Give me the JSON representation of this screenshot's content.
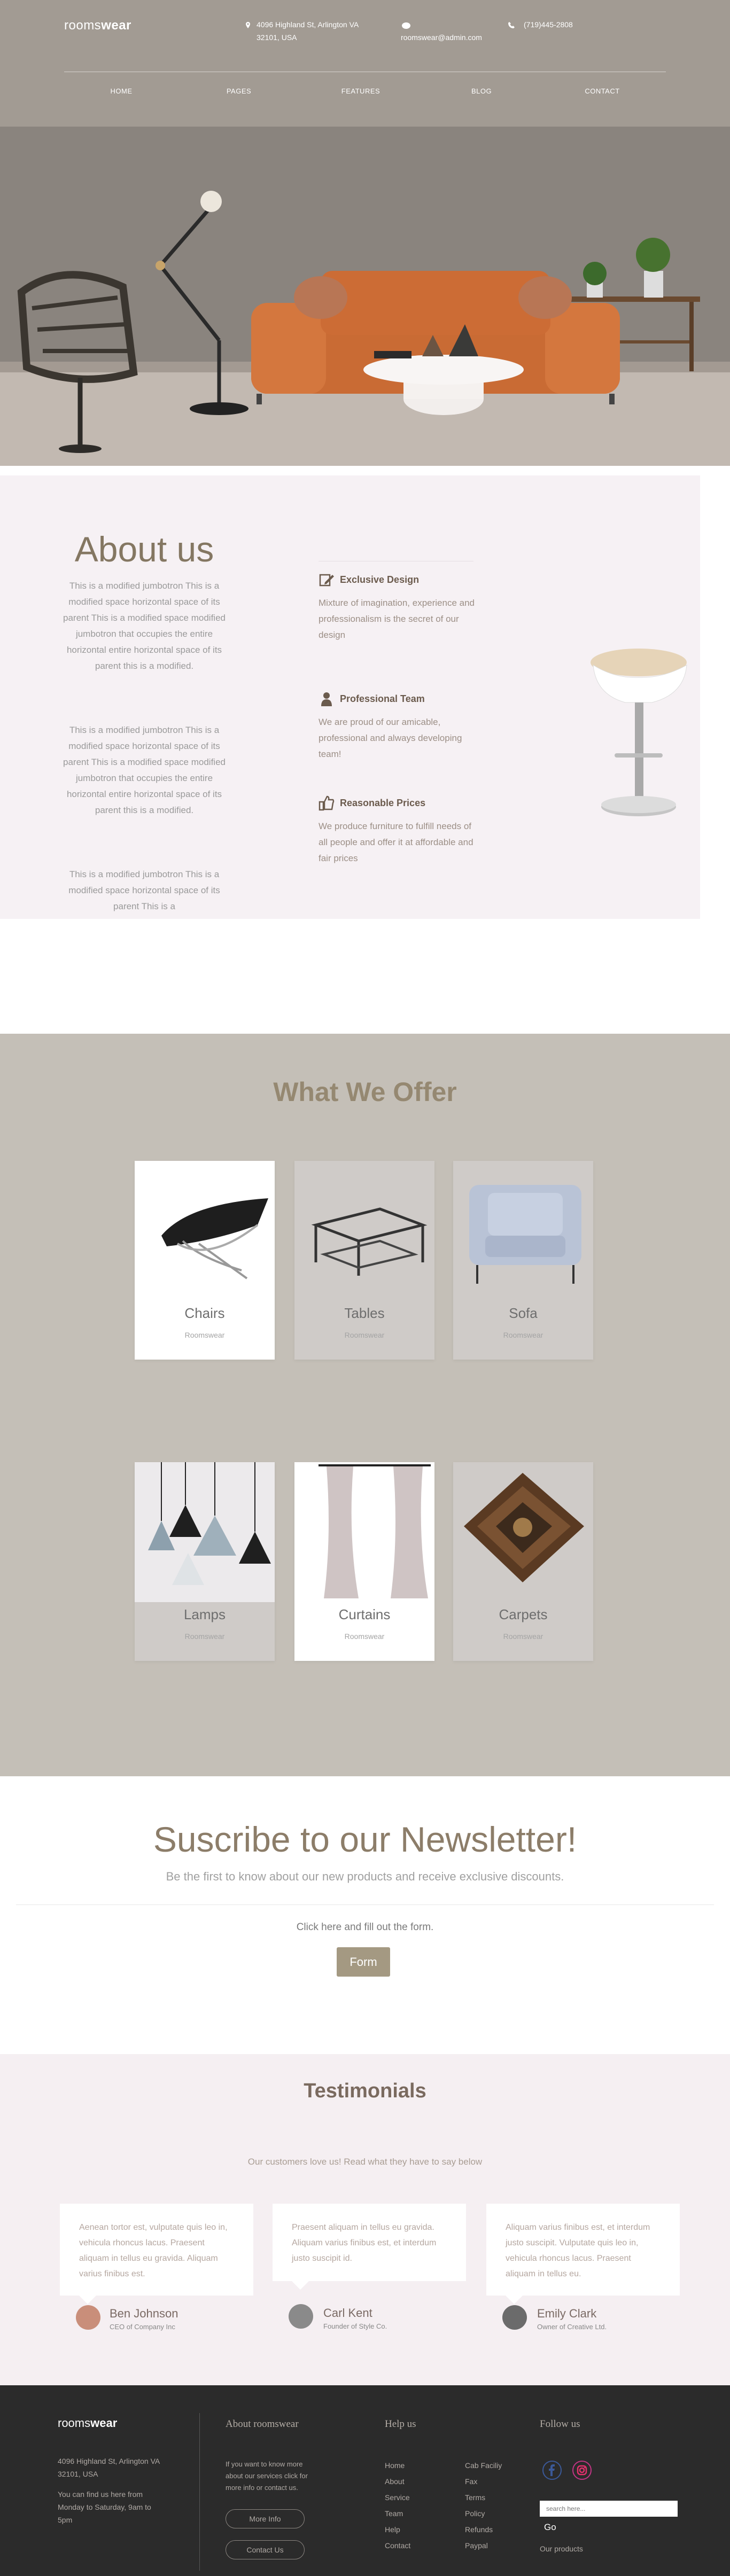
{
  "header": {
    "logo_light": "rooms",
    "logo_bold": "wear",
    "address_line1": "4096 Highland St, Arlington VA",
    "address_line2": "32101, USA",
    "email": "roomswear@admin.com",
    "phone": "(719)445-2808",
    "nav": [
      "HOME",
      "PAGES",
      "FEATURES",
      "BLOG",
      "CONTACT"
    ]
  },
  "about": {
    "title": "About us",
    "paragraphs": [
      "This is a modified jumbotron This is a modified space horizontal space of its parent This is a modified space modified jumbotron that occupies the entire horizontal entire horizontal space of its parent this is a modified.",
      "This is a modified jumbotron This is a modified space horizontal space of its parent This is a modified space modified jumbotron that occupies the entire horizontal entire horizontal space of its parent this is a modified.",
      "This is a modified jumbotron This is a modified space horizontal space of its parent This is a"
    ],
    "features": [
      {
        "title": "Exclusive Design",
        "text": "Mixture of imagination, experience and professionalism is the secret of our design",
        "icon": "edit-icon"
      },
      {
        "title": "Professional Team",
        "text": "We are proud of our amicable, professional and always developing team!",
        "icon": "person-icon"
      },
      {
        "title": "Reasonable Prices",
        "text": "We produce furniture to fulfill needs of all people and offer it at affordable and fair prices",
        "icon": "thumbs-up-icon"
      }
    ]
  },
  "offer": {
    "title": "What We Offer",
    "cards": [
      {
        "title": "Chairs",
        "sub": "Roomswear",
        "icon": "chair-icon"
      },
      {
        "title": "Tables",
        "sub": "Roomswear",
        "icon": "table-icon"
      },
      {
        "title": "Sofa",
        "sub": "Roomswear",
        "icon": "sofa-icon"
      },
      {
        "title": "Lamps",
        "sub": "Roomswear",
        "icon": "lamp-icon"
      },
      {
        "title": "Curtains",
        "sub": "Roomswear",
        "icon": "curtain-icon"
      },
      {
        "title": "Carpets",
        "sub": "Roomswear",
        "icon": "carpet-icon"
      }
    ]
  },
  "newsletter": {
    "title": "Suscribe to our Newsletter!",
    "subtitle": "Be the first to know about our new products and receive exclusive discounts.",
    "cta": "Click here and fill out the form.",
    "button": "Form"
  },
  "testimonials": {
    "title": "Testimonials",
    "subtitle": "Our customers love us! Read what they have to say below",
    "items": [
      {
        "text": "Aenean tortor est, vulputate quis leo in, vehicula rhoncus lacus. Praesent aliquam in tellus eu gravida. Aliquam varius finibus est.",
        "name": "Ben Johnson",
        "role": "CEO of Company Inc"
      },
      {
        "text": "Praesent aliquam in tellus eu gravida. Aliquam varius finibus est, et interdum justo suscipit id.",
        "name": "Carl Kent",
        "role": "Founder of Style Co."
      },
      {
        "text": "Aliquam varius finibus est, et interdum justo suscipit. Vulputate quis leo in, vehicula rhoncus lacus. Praesent aliquam in tellus eu.",
        "name": "Emily Clark",
        "role": "Owner of Creative Ltd."
      }
    ]
  },
  "footer": {
    "logo_light": "rooms",
    "logo_bold": "wear",
    "address": "4096 Highland St, Arlington VA 32101, USA",
    "hours": "You can find us here from Monday to Saturday, 9am to 5pm",
    "about_title": "About roomswear",
    "about_text": "If you want to know more about our services click for more info or contact us.",
    "more_info": "More Info",
    "contact_us": "Contact Us",
    "help_title": "Help us",
    "help_col1": [
      "Home",
      "About",
      "Service",
      "Team",
      "Help",
      "Contact"
    ],
    "help_col2": [
      "Cab Faciliy",
      "Fax",
      "Terms",
      "Policy",
      "Refunds",
      "Paypal"
    ],
    "follow_title": "Follow us",
    "search_placeholder": "search here...",
    "go": "Go",
    "our_products": "Our products"
  }
}
